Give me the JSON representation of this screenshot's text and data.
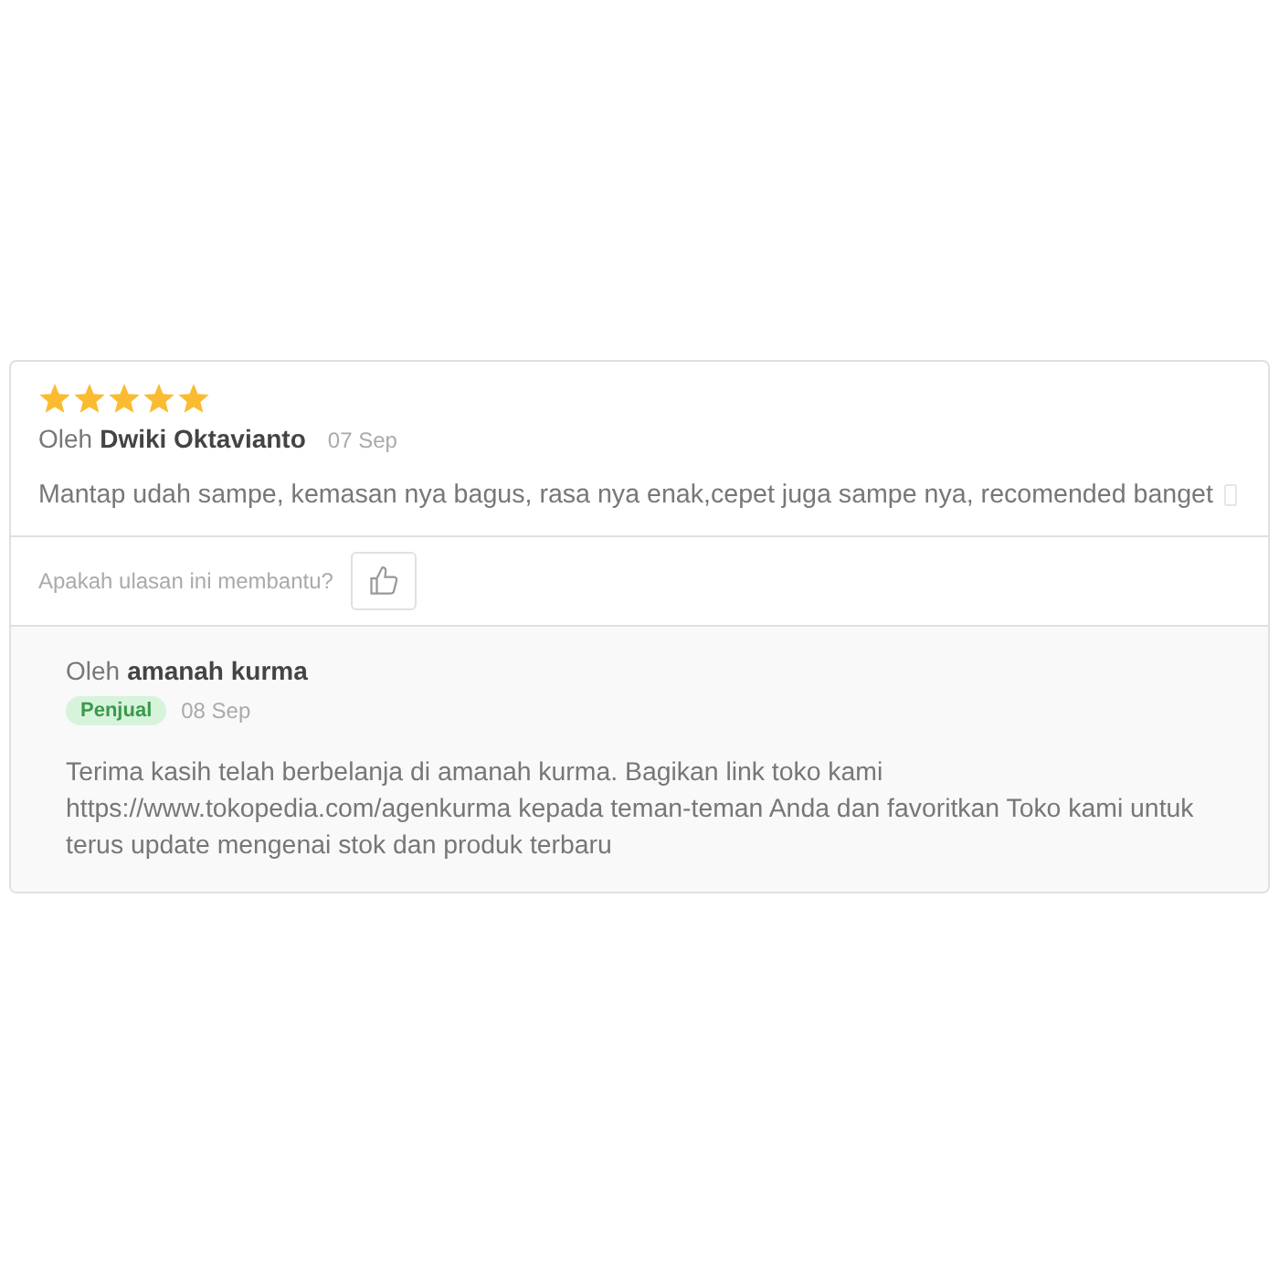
{
  "review": {
    "stars": 5,
    "by_label": "Oleh",
    "author": "Dwiki Oktavianto",
    "date": "07 Sep",
    "text": "Mantap udah sampe, kemasan nya bagus, rasa nya enak,cepet juga sampe nya, recomended banget",
    "helpful_question": "Apakah ulasan ini membantu?",
    "liked": false
  },
  "reply": {
    "by_label": "Oleh",
    "author": "amanah kurma",
    "badge": "Penjual",
    "date": "08 Sep",
    "text": "Terima kasih telah berbelanja di amanah kurma. Bagikan link toko kami https://www.tokopedia.com/agenkurma kepada teman-teman Anda dan favoritkan Toko kami untuk terus update mengenai stok dan produk terbaru"
  }
}
